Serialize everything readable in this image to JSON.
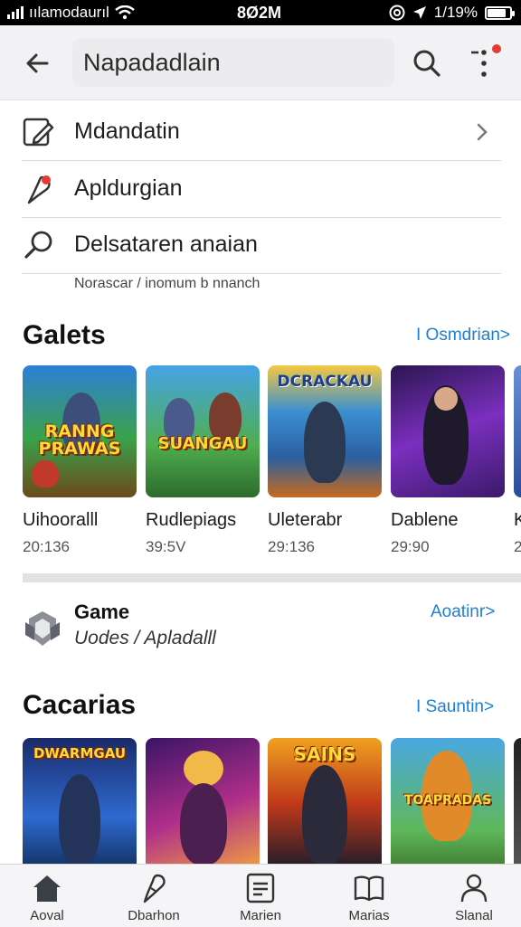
{
  "status_bar": {
    "carrier": "ıılamodaurıl",
    "time": "8Ø2M",
    "battery_text": "1/19%",
    "battery_level": 0.85
  },
  "app_bar": {
    "title": "Napadadlain",
    "back_icon": "arrow-left-icon",
    "search_icon": "search-icon",
    "more_icon": "more-vertical-icon"
  },
  "menu": {
    "items": [
      {
        "label": "Mdandatin",
        "icon": "edit-note-icon",
        "has_chevron": true
      },
      {
        "label": "Apldurgian",
        "icon": "pin-icon"
      },
      {
        "label": "Delsataren anaian",
        "icon": "search-icon"
      }
    ],
    "caption": "Norascar / inomum b nnanch"
  },
  "section_galets": {
    "title": "Galets",
    "link": "I Osmdrian>",
    "cards": [
      {
        "art_title": "RANNG PRAWAS",
        "name": "Uihooralll",
        "size": "20:136"
      },
      {
        "art_title": "SUANGAU",
        "name": "Rudlepiags",
        "size": "39:5V"
      },
      {
        "art_title": "DCRACKAU",
        "name": "Uleterabr",
        "size": "29:136"
      },
      {
        "art_title": "",
        "name": "Dablene",
        "size": "29:90"
      },
      {
        "art_title": "",
        "name": "K",
        "size": "2"
      }
    ]
  },
  "game_item": {
    "title": "Game",
    "subtitle": "Uodes / Apladalll",
    "link": "Aoatinr>",
    "logo_icon": "game-logo-icon"
  },
  "section_cacarias": {
    "title": "Cacarias",
    "link": "I Sauntin>",
    "cards": [
      {
        "art_title": "DWARMGAU"
      },
      {
        "art_title": ""
      },
      {
        "art_title": "SAINS"
      },
      {
        "art_title": "TOAPRADAS"
      }
    ]
  },
  "bottom_nav": {
    "items": [
      {
        "label": "Aoval",
        "icon": "home-icon"
      },
      {
        "label": "Dbarhon",
        "icon": "microphone-icon"
      },
      {
        "label": "Marien",
        "icon": "list-icon"
      },
      {
        "label": "Marias",
        "icon": "book-icon"
      },
      {
        "label": "Slanal",
        "icon": "person-icon"
      }
    ]
  }
}
